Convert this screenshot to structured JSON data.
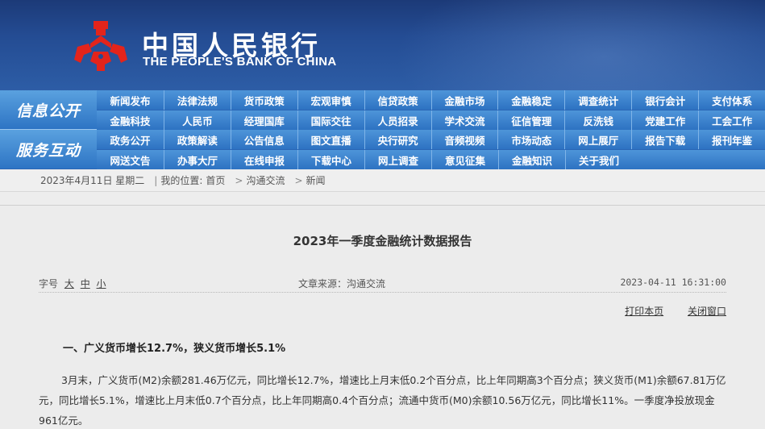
{
  "header": {
    "title_cn": "中国人民银行",
    "title_en": "THE PEOPLE'S BANK OF CHINA",
    "colors": {
      "bg": "#244c93",
      "logo": "#e3241b"
    }
  },
  "nav": {
    "section1": "信息公开",
    "section2": "服务互动",
    "rows": [
      [
        "新闻发布",
        "法律法规",
        "货币政策",
        "宏观审慎",
        "信贷政策",
        "金融市场",
        "金融稳定",
        "调查统计",
        "银行会计",
        "支付体系"
      ],
      [
        "金融科技",
        "人民币",
        "经理国库",
        "国际交往",
        "人员招录",
        "学术交流",
        "征信管理",
        "反洗钱",
        "党建工作",
        "工会工作"
      ],
      [
        "政务公开",
        "政策解读",
        "公告信息",
        "图文直播",
        "央行研究",
        "音频视频",
        "市场动态",
        "网上展厅",
        "报告下载",
        "报刊年鉴"
      ],
      [
        "网送文告",
        "办事大厅",
        "在线申报",
        "下载中心",
        "网上调查",
        "意见征集",
        "金融知识",
        "关于我们"
      ]
    ]
  },
  "breadcrumb": {
    "date": "2023年4月11日 星期二",
    "location_label": "我的位置:",
    "items": [
      "首页",
      "沟通交流",
      "新闻"
    ],
    "separator": ">"
  },
  "article": {
    "title": "2023年一季度金融统计数据报告",
    "font_size_label": "字号",
    "font_sizes": [
      "大",
      "中",
      "小"
    ],
    "source": "文章来源：沟通交流",
    "date": "2023-04-11 16:31:00",
    "print_label": "打印本页",
    "close_label": "关闭窗口",
    "section_heading": "一、广义货币增长12.7%，狭义货币增长5.1%",
    "paragraph": "3月末，广义货币(M2)余额281.46万亿元，同比增长12.7%，增速比上月末低0.2个百分点，比上年同期高3个百分点；狭义货币(M1)余额67.81万亿元，同比增长5.1%，增速比上月末低0.7个百分点，比上年同期高0.4个百分点；流通中货币(M0)余额10.56万亿元，同比增长11%。一季度净投放现金961亿元。"
  }
}
